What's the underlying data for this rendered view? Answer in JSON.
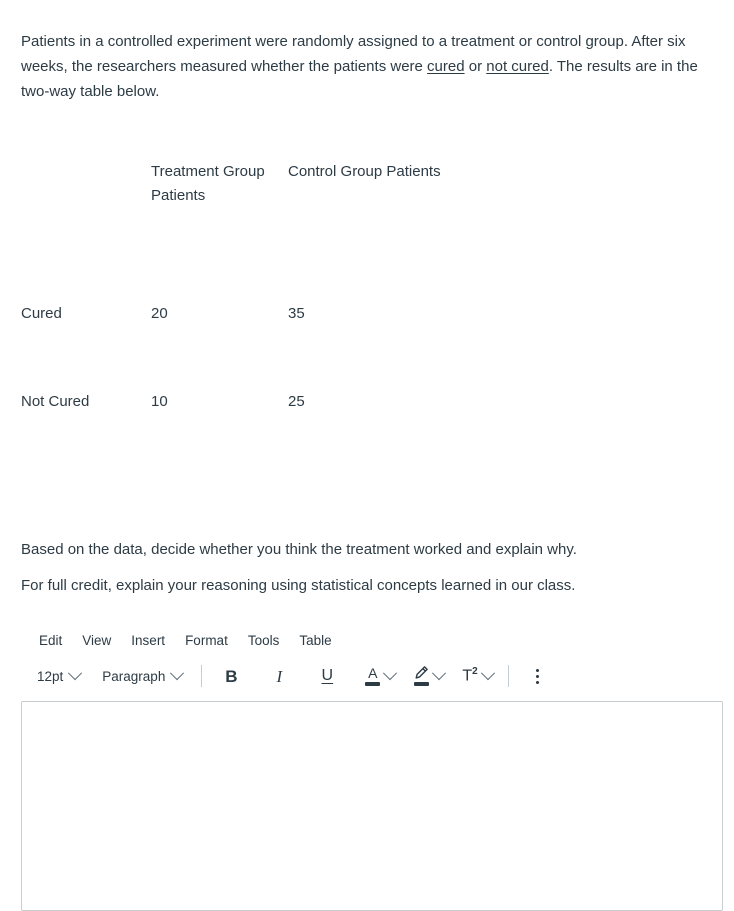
{
  "question": {
    "intro_parts": [
      {
        "text": "Patients in a controlled experiment were randomly assigned to a treatment or control group. After six weeks, the researchers measured whether the patients were ",
        "underline": false
      },
      {
        "text": "cured",
        "underline": true
      },
      {
        "text": " or ",
        "underline": false
      },
      {
        "text": "not cured",
        "underline": true
      },
      {
        "text": ". The results are in the two-way table below.",
        "underline": false
      }
    ],
    "intro_plain": "Patients in a controlled experiment were randomly assigned to a treatment or control group. After six weeks, the researchers measured whether the patients were cured or not cured. The results are in the two-way table below.",
    "prompt_line_1": "Based on the data, decide whether you think the treatment worked and explain why.",
    "prompt_line_2": "For full credit, explain your reasoning using statistical concepts learned in our class."
  },
  "table": {
    "corner_label": "",
    "headers": {
      "col1": "Treatment Group Patients",
      "col2": "Control Group Patients"
    },
    "rows": [
      {
        "label": "Cured",
        "treatment": "20",
        "control": "35"
      },
      {
        "label": "Not Cured",
        "treatment": "10",
        "control": "25"
      }
    ]
  },
  "editor": {
    "menubar": [
      {
        "label": "Edit",
        "name": "menu-edit"
      },
      {
        "label": "View",
        "name": "menu-view"
      },
      {
        "label": "Insert",
        "name": "menu-insert"
      },
      {
        "label": "Format",
        "name": "menu-format"
      },
      {
        "label": "Tools",
        "name": "menu-tools"
      },
      {
        "label": "Table",
        "name": "menu-table"
      }
    ],
    "toolbar": {
      "font_size": "12pt",
      "block_format": "Paragraph",
      "bold": "B",
      "italic": "I",
      "underline": "U",
      "text_color": "A",
      "highlight": "highlighter",
      "superscript": "T",
      "superscript_exponent": "2",
      "more_options": "more-options"
    },
    "body_value": "",
    "body_placeholder": ""
  },
  "colors": {
    "text": "#2d3b45",
    "border": "#c7cdd1",
    "background": "#ffffff"
  }
}
